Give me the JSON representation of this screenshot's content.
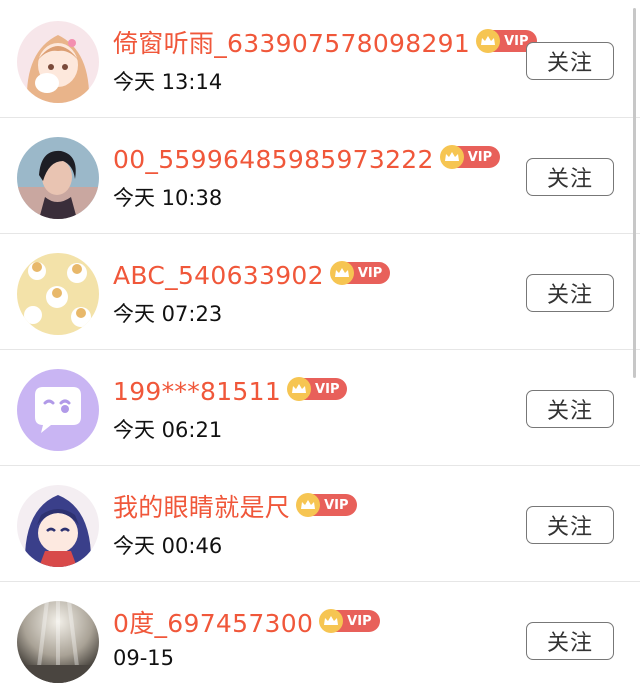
{
  "follow_label": "关注",
  "vip_label": "VIP",
  "colors": {
    "name": "#f0573a",
    "vip_badge": "#e8605a",
    "crown": "#f6c552",
    "divider": "#e6e6e6"
  },
  "users": [
    {
      "name": "倚窗听雨_633907578098291",
      "time": "今天 13:14",
      "avatar": "anime-girl-pink-avatar"
    },
    {
      "name": "00_55996485985973222",
      "time": "今天 10:38",
      "avatar": "dark-hair-portrait-avatar"
    },
    {
      "name": "ABC_540633902",
      "time": "今天 07:23",
      "avatar": "cartoon-pattern-avatar"
    },
    {
      "name": "199***81511",
      "time": "今天 06:21",
      "avatar": "default-chat-bubble-avatar"
    },
    {
      "name": "我的眼睛就是尺",
      "time": "今天 00:46",
      "avatar": "anime-girl-blue-hair-avatar"
    },
    {
      "name": "0度_697457300",
      "time": "09-15",
      "avatar": "light-rays-photo-avatar"
    }
  ]
}
